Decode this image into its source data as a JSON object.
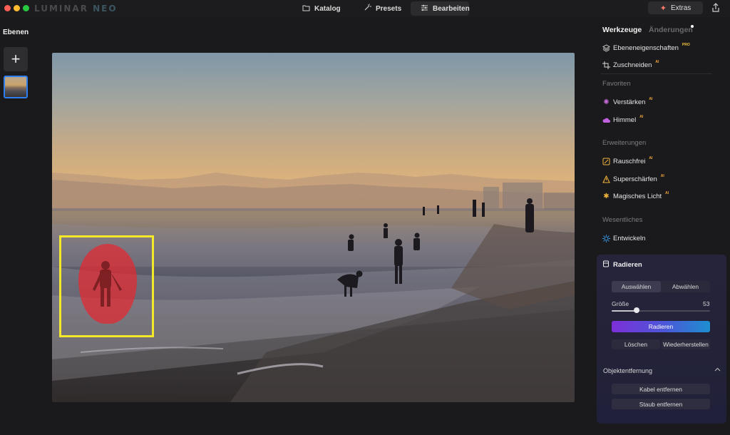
{
  "app": {
    "logo_main": "LUMINAR",
    "logo_sub": "NEO"
  },
  "topnav": {
    "katalog": "Katalog",
    "presets": "Presets",
    "bearbeiten": "Bearbeiten",
    "active": "Bearbeiten"
  },
  "extras": {
    "label": "Extras"
  },
  "layers": {
    "title": "Ebenen",
    "add_symbol": "+"
  },
  "tabs": {
    "werkzeuge": "Werkzeuge",
    "aenderungen": "Änderungen",
    "active": "Werkzeuge"
  },
  "tools": {
    "ebeneneigenschaften": {
      "label": "Ebeneneigenschaften",
      "badge": "PRO"
    },
    "zuschneiden": {
      "label": "Zuschneiden",
      "badge": "AI"
    }
  },
  "sections": {
    "favoriten": {
      "title": "Favoriten",
      "items": [
        {
          "label": "Verstärken",
          "badge": "AI",
          "icon": "sparkle-icon",
          "color": "#c76bd8"
        },
        {
          "label": "Himmel",
          "badge": "AI",
          "icon": "cloud-icon",
          "color": "#c061e0"
        }
      ]
    },
    "erweiterungen": {
      "title": "Erweiterungen",
      "items": [
        {
          "label": "Rauschfrei",
          "badge": "AI",
          "icon": "noise-icon",
          "color": "#f0b23c"
        },
        {
          "label": "Superschärfen",
          "badge": "AI",
          "icon": "triangle-icon",
          "color": "#f0b23c"
        },
        {
          "label": "Magisches Licht",
          "badge": "AI",
          "icon": "light-icon",
          "color": "#f0b23c"
        }
      ]
    },
    "wesentliches": {
      "title": "Wesentliches",
      "items": [
        {
          "label": "Entwickeln",
          "icon": "sun-icon",
          "color": "#3aa0f0"
        }
      ]
    }
  },
  "erase_panel": {
    "title": "Radieren",
    "segment": {
      "select": "Auswählen",
      "deselect": "Abwählen",
      "active": "Auswählen"
    },
    "size": {
      "label": "Größe",
      "value": "53",
      "fraction": 0.25
    },
    "erase_button": "Radieren",
    "clear_button": "Löschen",
    "restore_button": "Wiederherstellen",
    "object_removal": {
      "title": "Objektentfernung",
      "cable_button": "Kabel entfernen",
      "dust_button": "Staub entfernen"
    }
  },
  "colors": {
    "accent_blue": "#2d7ef0",
    "selection_yellow": "#f3e92a",
    "mask_red": "#e62830"
  }
}
